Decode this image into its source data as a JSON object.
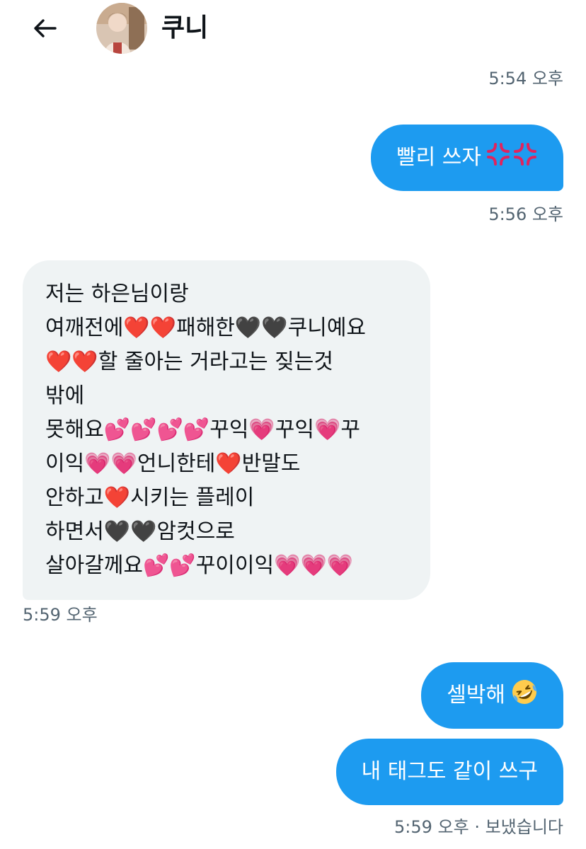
{
  "header": {
    "contact_name": "쿠니"
  },
  "messages": [
    {
      "type": "timestamp",
      "side": "right",
      "text": "5:54 오후"
    },
    {
      "type": "outgoing",
      "text": "빨리 쓰자 "
    },
    {
      "type": "timestamp",
      "side": "right",
      "text": "5:56 오후"
    },
    {
      "type": "incoming",
      "lines": [
        "저는 하은님이랑",
        "여깨전에❤️❤️패해한🖤🖤쿠니예요",
        "❤️❤️할 줄아는 거라고는 짖는것",
        "밖에",
        "못해요💕💕💕💕꾸익💗꾸익💗꾸",
        "이익💗💗언니한테❤️반말도",
        "안하고❤️시키는 플레이",
        "하면서🖤🖤암컷으로",
        "살아갈께요💕💕꾸이이익💗💗💗"
      ]
    },
    {
      "type": "timestamp",
      "side": "left",
      "text": "5:59 오후"
    },
    {
      "type": "outgoing",
      "text": "셀박해 "
    },
    {
      "type": "outgoing",
      "text": "내 태그도 같이 쓰구"
    },
    {
      "type": "timestamp",
      "side": "right",
      "text": "5:59 오후 · 보냈습니다"
    }
  ],
  "icons": {
    "back": "arrow-left-icon",
    "angry": "anger-symbol-icon",
    "laugh": "rolling-laughing-face-icon"
  },
  "colors": {
    "outgoing_bubble": "#1d9bf0",
    "incoming_bubble": "#eff3f4",
    "timestamp": "#536471",
    "text": "#0f1419"
  }
}
